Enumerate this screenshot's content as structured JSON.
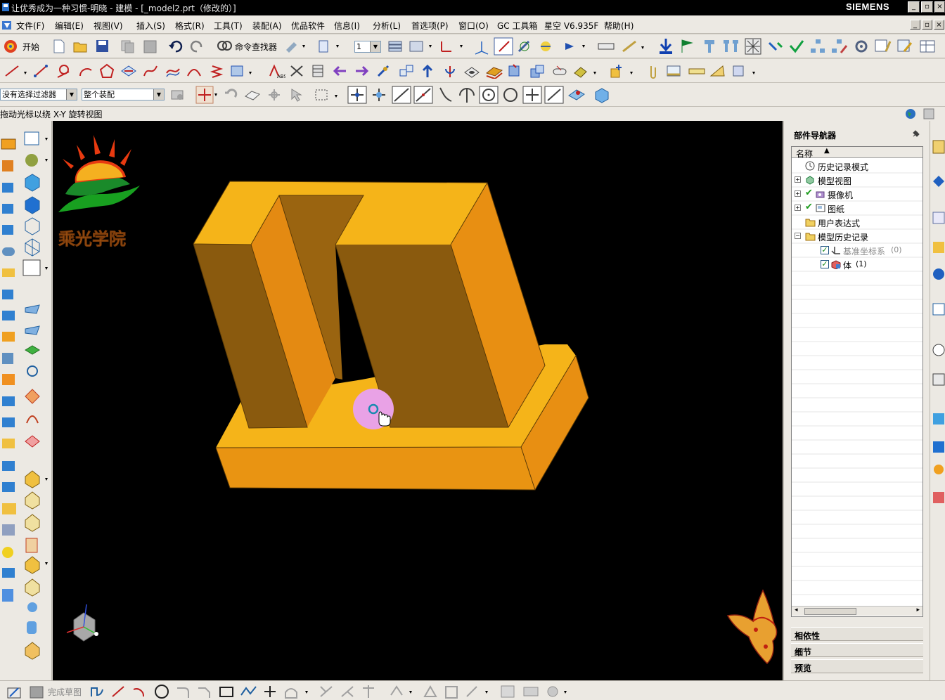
{
  "window": {
    "title": "让优秀成为一种习惯-明晓 - 建模 - [_model2.prt（修改的）]",
    "brand": "SIEMENS"
  },
  "menu": [
    "文件(F)",
    "编辑(E)",
    "视图(V)",
    "插入(S)",
    "格式(R)",
    "工具(T)",
    "装配(A)",
    "优品软件",
    "信息(I)",
    "分析(L)",
    "首选项(P)",
    "窗口(O)",
    "GC 工具箱",
    "星空 V6.935F",
    "帮助(H)"
  ],
  "toolbar1": {
    "start_label": "开始",
    "command_finder_label": "命令查找器",
    "layer_value": "1"
  },
  "selection": {
    "filter_value": "没有选择过滤器",
    "scope_value": "整个装配"
  },
  "status_hint": "拖动光标以绕 X-Y 旋转视图",
  "logo_text": "乘光学院",
  "navigator": {
    "title": "部件导航器",
    "column_header": "名称",
    "items": [
      {
        "label": "历史记录模式"
      },
      {
        "label": "模型视图"
      },
      {
        "label": "摄像机"
      },
      {
        "label": "图纸"
      },
      {
        "label": "用户表达式"
      },
      {
        "label": "模型历史记录"
      },
      {
        "label": "基准坐标系",
        "count": "(0)"
      },
      {
        "label": "体",
        "count": "(1)"
      }
    ],
    "panels": [
      "相依性",
      "细节",
      "预览"
    ]
  },
  "bottom": {
    "finish_sketch_label": "完成草图"
  },
  "colors": {
    "part_top": "#f5b419",
    "part_side_dark": "#8a5a0e",
    "part_side_mid": "#e88f12",
    "viewport_bg": "#000000",
    "cursor_highlight": "#e9a2e6"
  }
}
